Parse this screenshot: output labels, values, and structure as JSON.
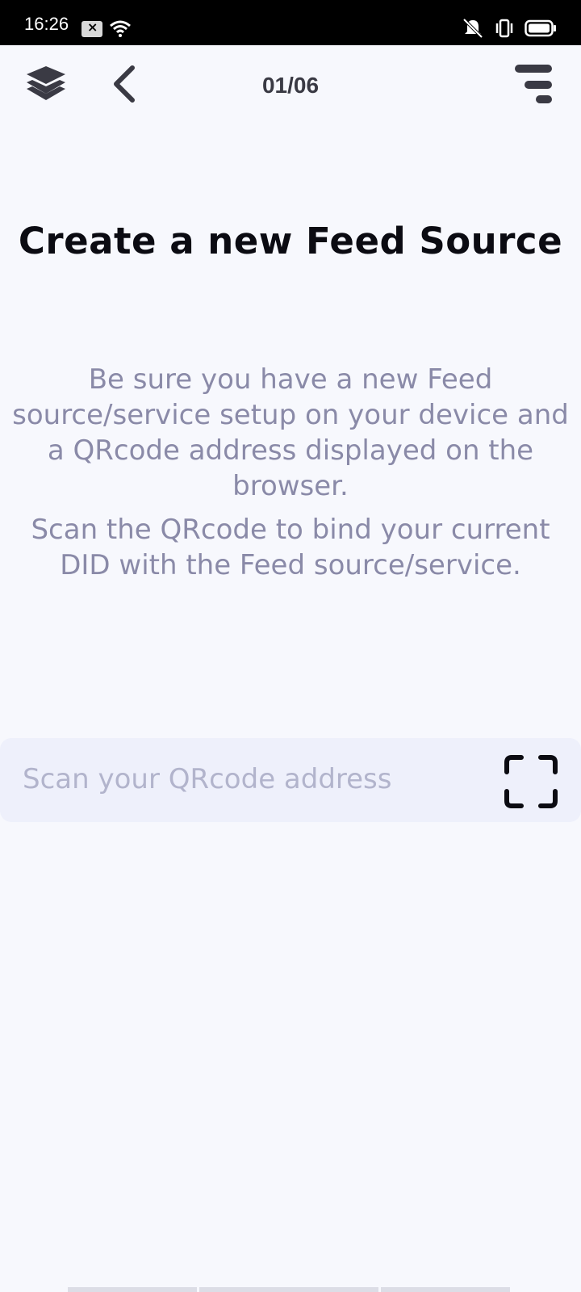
{
  "status_bar": {
    "time": "16:26",
    "icons": [
      "notification-x-icon",
      "wifi-icon",
      "vibrate-off-icon",
      "vibrate-icon",
      "battery-icon"
    ]
  },
  "header": {
    "page_counter": "01/06",
    "icons": [
      "layers-icon",
      "back-chevron-icon",
      "filter-menu-icon"
    ]
  },
  "main": {
    "title": "Create a new Feed Source",
    "description_lines_1": [
      "Be sure you have a new Feed",
      "source/service setup on your device and",
      "a QRcode address displayed on the",
      "browser."
    ],
    "description_lines_2": [
      "Scan the QRcode to bind your current",
      "DID with the Feed source/service."
    ]
  },
  "scan_input": {
    "placeholder": "Scan your QRcode address",
    "icon": "qr-scan-icon"
  },
  "colors": {
    "background": "#f7f8fd",
    "title": "#0b0b12",
    "description": "#8a8aa8",
    "input_bg": "#eef0fb",
    "placeholder": "#b2b4cc"
  }
}
